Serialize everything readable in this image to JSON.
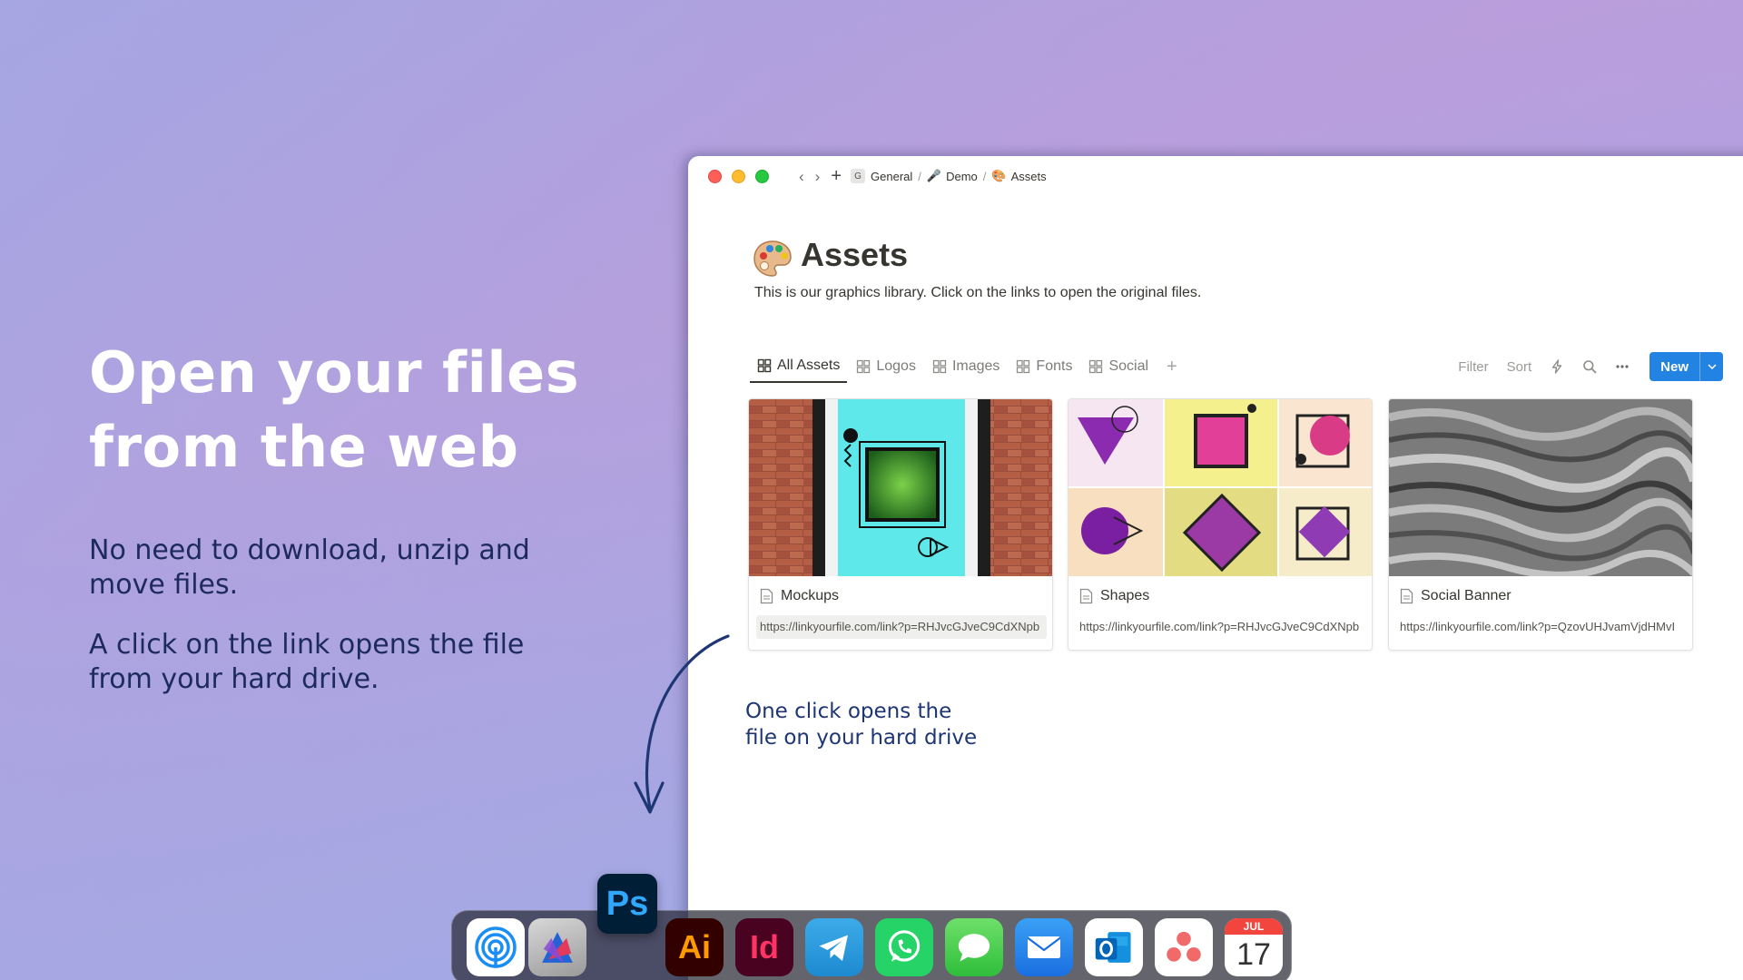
{
  "marketing": {
    "headline_line1": "Open your files",
    "headline_line2": "from the web",
    "para1_line1": "No need to download, unzip and",
    "para1_line2": "move files.",
    "para2_line1": "A click on the link opens the file",
    "para2_line2": "from your hard drive."
  },
  "window": {
    "breadcrumb": [
      {
        "label": "General",
        "icon": "G"
      },
      {
        "label": "Demo",
        "icon": "microphone-icon"
      },
      {
        "label": "Assets",
        "icon": "palette-icon"
      }
    ],
    "separator": "/",
    "page_title": "Assets",
    "page_icon": "palette-icon",
    "page_description": "This is our graphics library. Click on the links to open the original files.",
    "views": [
      {
        "label": "All Assets",
        "active": true
      },
      {
        "label": "Logos",
        "active": false
      },
      {
        "label": "Images",
        "active": false
      },
      {
        "label": "Fonts",
        "active": false
      },
      {
        "label": "Social",
        "active": false
      }
    ],
    "actions": {
      "filter": "Filter",
      "sort": "Sort",
      "new_label": "New"
    },
    "cards": [
      {
        "title": "Mockups",
        "link": "https://linkyourfile.com/link?p=RHJvcGJveC9CdXNpb",
        "selected": true
      },
      {
        "title": "Shapes",
        "link": "https://linkyourfile.com/link?p=RHJvcGJveC9CdXNpb",
        "selected": false
      },
      {
        "title": "Social Banner",
        "link": "https://linkyourfile.com/link?p=QzovUHJvamVjdHMvI",
        "selected": false
      }
    ],
    "callout_line1": "One click opens the",
    "callout_line2": "file on your hard drive"
  },
  "dock": {
    "apps": [
      "airdrop-icon",
      "affinity-icon",
      "illustrator-icon",
      "indesign-icon",
      "telegram-icon",
      "whatsapp-icon",
      "messages-icon",
      "mail-icon",
      "outlook-icon",
      "asana-icon",
      "calendar-icon"
    ],
    "floating_app": "Ps",
    "illustrator_label": "Ai",
    "indesign_label": "Id",
    "calendar_month": "JUL",
    "calendar_day": "17"
  },
  "colors": {
    "accent_blue": "#2383e2",
    "callout_text": "#1e3674",
    "headline_text": "#ffffff"
  }
}
